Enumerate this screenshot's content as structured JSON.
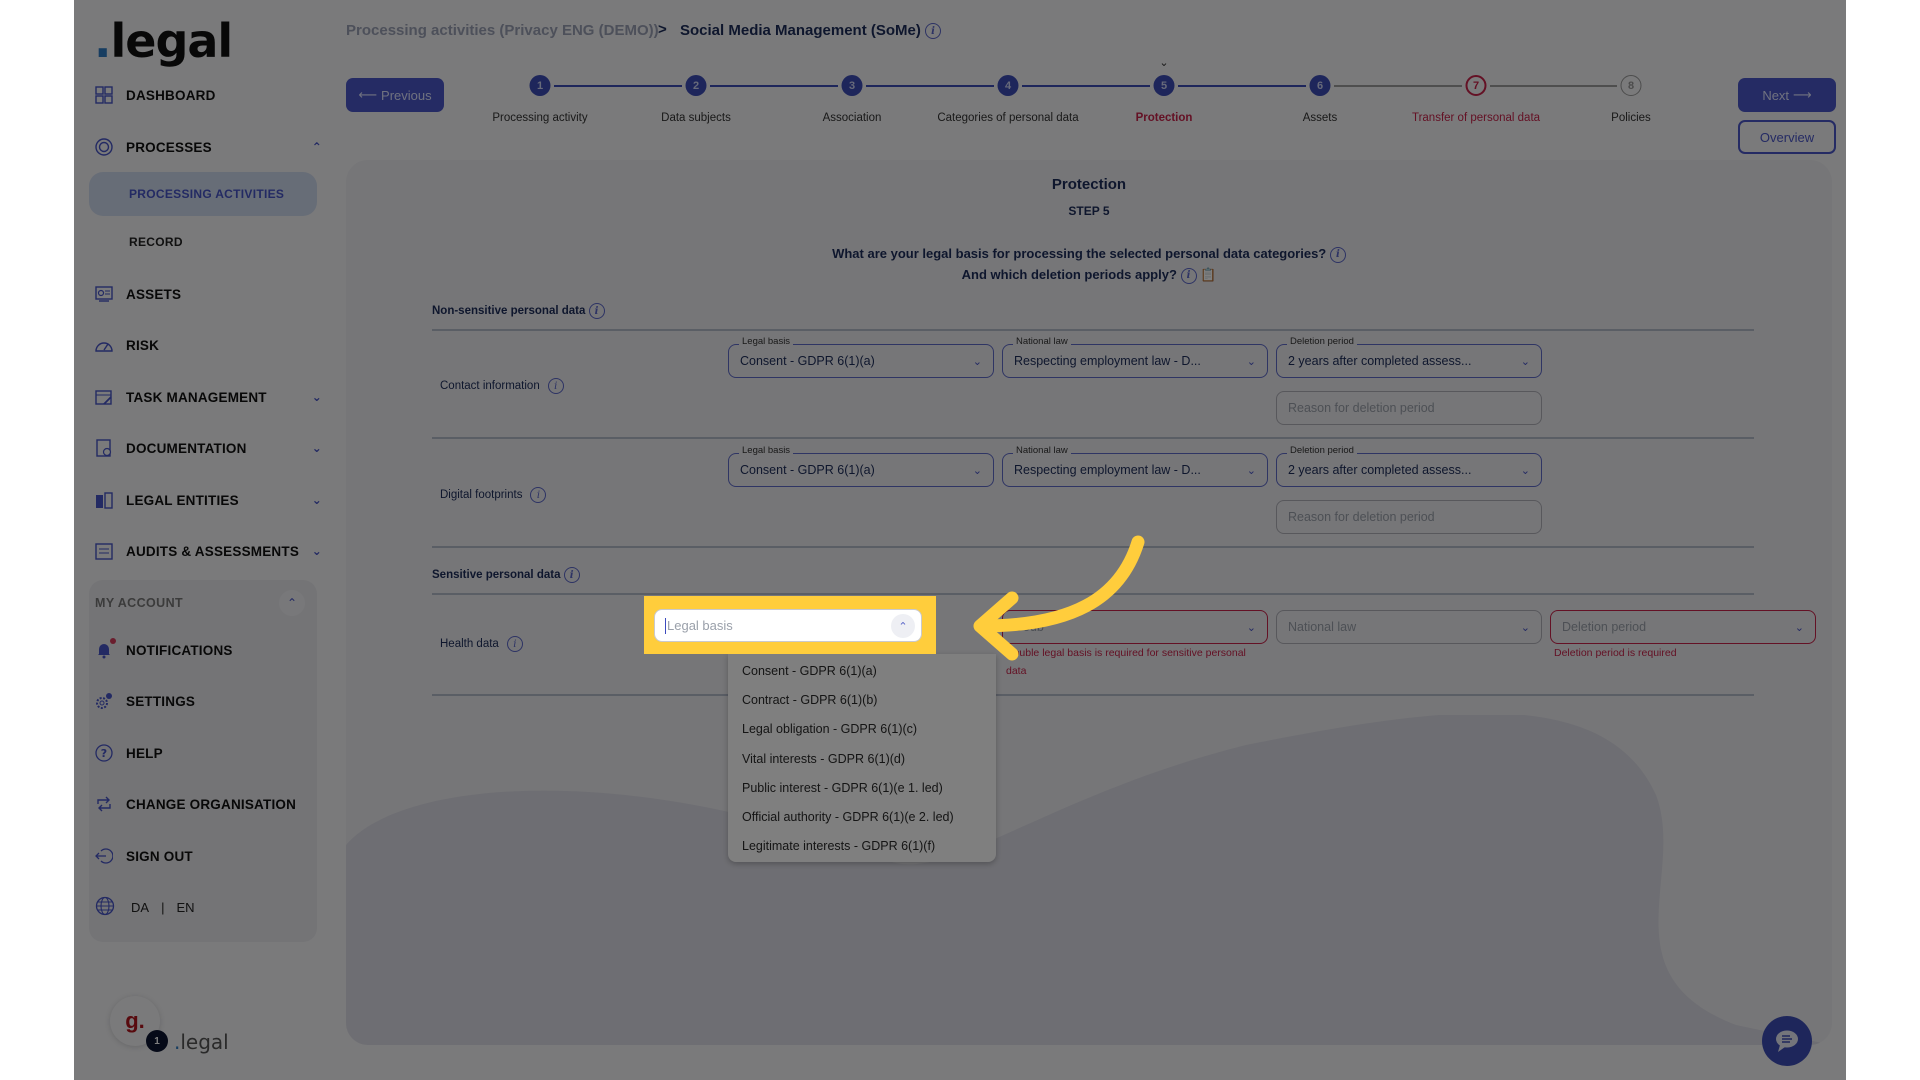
{
  "brand": {
    "logo_dot": ".",
    "logo_text": "legal"
  },
  "sidebar": {
    "items": [
      {
        "label": "Dashboard",
        "icon": "dashboard-grid-icon"
      },
      {
        "label": "Processes",
        "icon": "processes-icon",
        "expanded": true,
        "children": [
          {
            "label": "Processing activities",
            "active": true
          },
          {
            "label": "Record"
          }
        ]
      },
      {
        "label": "Assets",
        "icon": "assets-icon"
      },
      {
        "label": "Risk",
        "icon": "risk-gauge-icon"
      },
      {
        "label": "Task management",
        "icon": "task-icon"
      },
      {
        "label": "Documentation",
        "icon": "documentation-icon"
      },
      {
        "label": "Legal entities",
        "icon": "building-icon"
      },
      {
        "label": "Audits & assessments",
        "icon": "audit-icon"
      }
    ],
    "account": {
      "heading": "My account",
      "items": [
        {
          "label": "Notifications",
          "icon": "bell-icon",
          "has_dot": true
        },
        {
          "label": "Settings",
          "icon": "gear-icon"
        },
        {
          "label": "Help",
          "icon": "help-icon"
        },
        {
          "label": "Change organisation",
          "icon": "swap-icon"
        },
        {
          "label": "Sign out",
          "icon": "sign-out-icon"
        }
      ],
      "languages": [
        "DA",
        "EN"
      ],
      "lang_separator": "|"
    },
    "footer": {
      "avatar_letter": "g.",
      "badge_count": "1",
      "brand": "legal"
    }
  },
  "breadcrumb": {
    "parent": "Processing activities (Privacy ENG (DEMO))",
    "separator": ">",
    "current": "Social Media Management (SoMe)"
  },
  "stepper": {
    "previous_label": "Previous",
    "next_label": "Next",
    "overview_label": "Overview",
    "steps": [
      {
        "num": "1",
        "label": "Processing activity",
        "state": "done"
      },
      {
        "num": "2",
        "label": "Data subjects",
        "state": "done"
      },
      {
        "num": "3",
        "label": "Association",
        "state": "done"
      },
      {
        "num": "4",
        "label": "Categories of personal data",
        "state": "done"
      },
      {
        "num": "5",
        "label": "Protection",
        "state": "active"
      },
      {
        "num": "6",
        "label": "Assets",
        "state": "done"
      },
      {
        "num": "7",
        "label": "Transfer of personal data",
        "state": "error"
      },
      {
        "num": "8",
        "label": "Policies",
        "state": "todo"
      }
    ]
  },
  "main": {
    "title": "Protection",
    "step": "STEP 5",
    "question_1": "What are your legal basis for processing the selected personal data categories?",
    "question_2": "And which deletion periods apply?",
    "non_sensitive_heading": "Non-sensitive personal data",
    "sensitive_heading": "Sensitive personal data",
    "rows": [
      {
        "label": "Contact information",
        "legal_basis_label": "Legal basis",
        "legal_basis": "Consent - GDPR 6(1)(a)",
        "national_law_label": "National law",
        "national_law": "Respecting employment law - D...",
        "deletion_label": "Deletion period",
        "deletion": "2 years after completed assess...",
        "reason_placeholder": "Reason for deletion period"
      },
      {
        "label": "Digital footprints",
        "legal_basis_label": "Legal basis",
        "legal_basis": "Consent - GDPR 6(1)(a)",
        "national_law_label": "National law",
        "national_law": "Respecting employment law - D...",
        "deletion_label": "Deletion period",
        "deletion": "2 years after completed assess...",
        "reason_placeholder": "Reason for deletion period"
      }
    ],
    "sensitive_row": {
      "label": "Health data",
      "legal_basis_placeholder": "Legal basis",
      "double_basis_placeholder": "Double legal basis",
      "double_basis_visible": "Doub",
      "double_basis_error": "Double legal basis is required for sensitive personal data",
      "national_law_placeholder": "National law",
      "deletion_placeholder": "Deletion period",
      "deletion_error": "Deletion period is required"
    },
    "legal_basis_options": [
      "Consent - GDPR 6(1)(a)",
      "Contract - GDPR 6(1)(b)",
      "Legal obligation - GDPR 6(1)(c)",
      "Vital interests - GDPR 6(1)(d)",
      "Public interest - GDPR 6(1)(e 1. led)",
      "Official authority - GDPR 6(1)(e 2. led)",
      "Legitimate interests - GDPR 6(1)(f)"
    ]
  },
  "colors": {
    "accent": "#4a56c8",
    "error": "#c8234a",
    "highlight": "#ffcd3c",
    "navy": "#1d2d5a"
  }
}
